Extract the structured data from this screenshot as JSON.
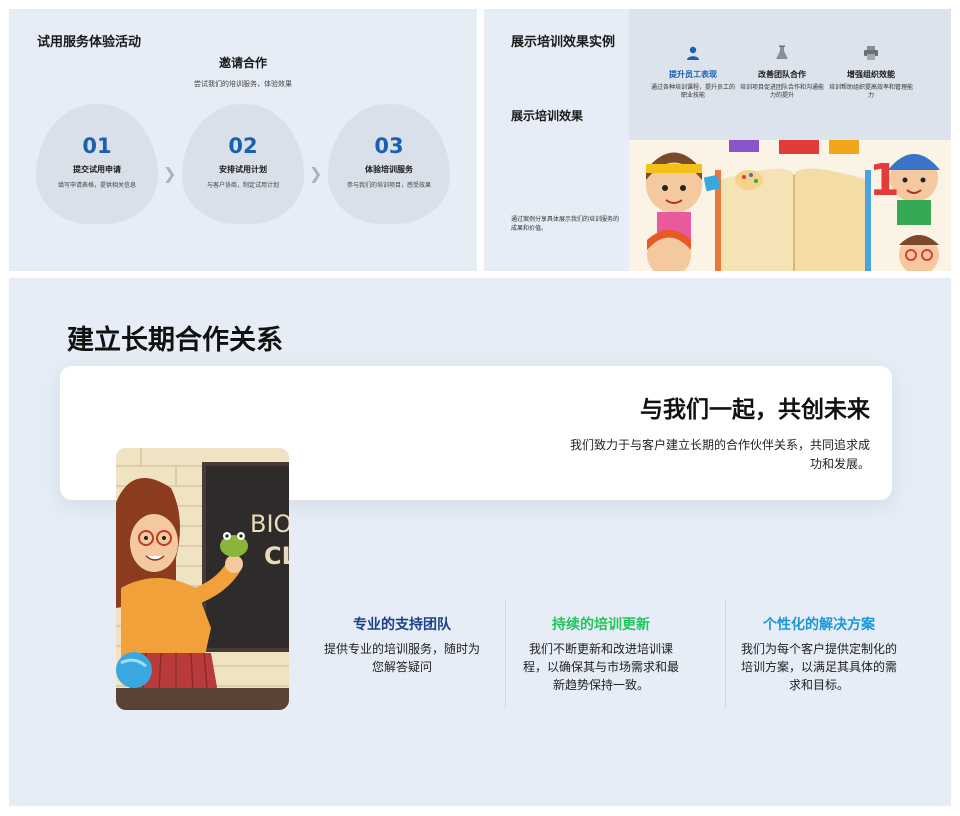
{
  "slide1": {
    "title": "试用服务体验活动",
    "heading": "邀请合作",
    "subtitle": "尝试我们的培训服务，体验效果",
    "steps": [
      {
        "num": "01",
        "title": "提交试用申请",
        "desc": "填写申请表格，提供相关信息"
      },
      {
        "num": "02",
        "title": "安排试用计划",
        "desc": "与客户协商，制定试用计划"
      },
      {
        "num": "03",
        "title": "体验培训服务",
        "desc": "参与我们的培训项目，感受效果"
      }
    ],
    "accent": "#1a5fb0"
  },
  "slide2": {
    "title": "展示培训效果实例",
    "subtitle": "展示培训效果",
    "desc": "通过案例分享具体展示我们的培训服务的成果和价值。",
    "features": [
      {
        "icon": "user-icon",
        "title": "提升员工表现",
        "desc": "通过各种培训课程，提升员工的职业技能",
        "color": "#1a5fb0"
      },
      {
        "icon": "flask-icon",
        "title": "改善团队合作",
        "desc": "培训项目促进团队合作和沟通能力的提升",
        "color": "#111111"
      },
      {
        "icon": "printer-icon",
        "title": "增强组织效能",
        "desc": "培训帮助组织提高效率和管理能力",
        "color": "#111111"
      }
    ]
  },
  "slide3": {
    "title": "建立长期合作关系",
    "headline": "与我们一起，共创未来",
    "desc": "我们致力于与客户建立长期的合作伙伴关系，共同追求成功和发展。",
    "blackboard_text": [
      "BIO",
      "CL"
    ],
    "columns": [
      {
        "title": "专业的支持团队",
        "desc": "提供专业的培训服务，随时为您解答疑问",
        "color": "#1e3f8a"
      },
      {
        "title": "持续的培训更新",
        "desc": "我们不断更新和改进培训课程，以确保其与市场需求和最新趋势保持一致。",
        "color": "#22c55e"
      },
      {
        "title": "个性化的解决方案",
        "desc": "我们为每个客户提供定制化的培训方案，以满足其具体的需求和目标。",
        "color": "#1b97d8"
      }
    ]
  }
}
